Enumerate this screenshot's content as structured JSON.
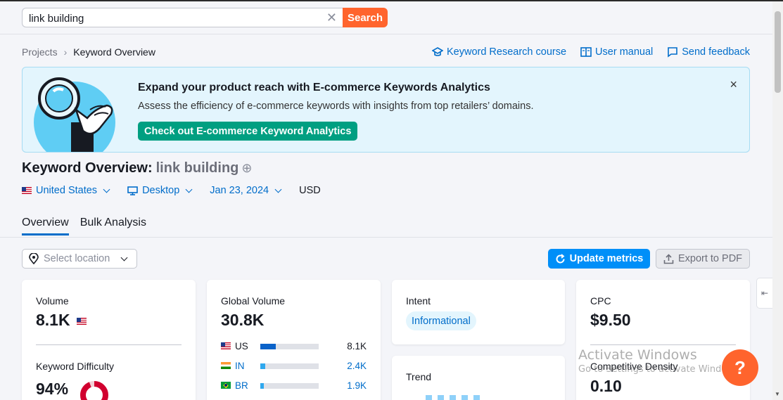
{
  "search": {
    "value": "link building",
    "button_label": "Search"
  },
  "breadcrumb": {
    "items": [
      "Projects",
      "Keyword Overview"
    ]
  },
  "toplinks": {
    "course": "Keyword Research course",
    "manual": "User manual",
    "feedback": "Send feedback"
  },
  "banner": {
    "title": "Expand your product reach with E-commerce Keywords Analytics",
    "text": "Assess the efficiency of e-commerce keywords with insights from top retailers’ domains.",
    "button_label": "Check out E-commerce Keyword Analytics",
    "close": "×"
  },
  "header": {
    "title": "Keyword Overview:",
    "keyword": "link building"
  },
  "filters": {
    "country": "United States",
    "device": "Desktop",
    "date": "Jan 23, 2024",
    "currency": "USD"
  },
  "tabs": [
    {
      "label": "Overview",
      "active": true
    },
    {
      "label": "Bulk Analysis",
      "active": false
    }
  ],
  "toolbar": {
    "location_placeholder": "Select location",
    "update_label": "Update metrics",
    "export_label": "Export to PDF"
  },
  "cards": {
    "volume": {
      "label": "Volume",
      "value": "8.1K"
    },
    "kd": {
      "label": "Keyword Difficulty",
      "value": "94%",
      "percent": 94
    },
    "global": {
      "label": "Global Volume",
      "value": "30.8K",
      "rows": [
        {
          "code": "US",
          "value": "8.1K",
          "share": 0.26
        },
        {
          "code": "IN",
          "value": "2.4K",
          "share": 0.08
        },
        {
          "code": "BR",
          "value": "1.9K",
          "share": 0.06
        }
      ]
    },
    "intent": {
      "label": "Intent",
      "badge": "Informational"
    },
    "trend": {
      "label": "Trend"
    },
    "cpc": {
      "label": "CPC",
      "value": "$9.50"
    },
    "density": {
      "label": "Competitive Density",
      "value": "0.10"
    }
  },
  "watermark": {
    "title": "Activate Windows",
    "sub": "Go to Settings to activate Windows."
  },
  "help": {
    "label": "?"
  },
  "colors": {
    "accent": "#006dca",
    "search": "#ff642d",
    "banner_button": "#009f81",
    "update": "#008ff8",
    "kd_ring": "#d1002f"
  }
}
